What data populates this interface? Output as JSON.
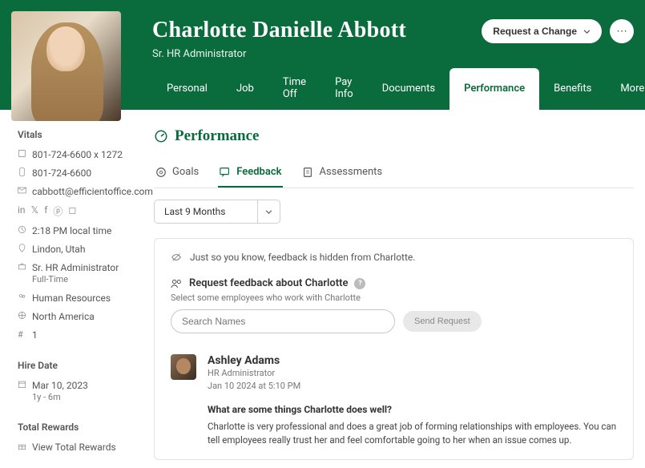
{
  "header": {
    "name": "Charlotte Danielle Abbott",
    "subtitle": "Sr. HR Administrator",
    "request_change_label": "Request a Change",
    "nav": [
      "Personal",
      "Job",
      "Time Off",
      "Pay Info",
      "Documents",
      "Performance",
      "Benefits",
      "More"
    ],
    "active_nav_index": 5
  },
  "sidebar": {
    "vitals_heading": "Vitals",
    "phone_ext": "801-724-6600 x 1272",
    "phone": "801-724-6600",
    "email": "cabbott@efficientoffice.com",
    "local_time": "2:18 PM local time",
    "location": "Lindon, Utah",
    "title": "Sr. HR Administrator",
    "employment_type": "Full-Time",
    "department": "Human Resources",
    "region": "North America",
    "number": "1",
    "hire_heading": "Hire Date",
    "hire_date": "Mar 10, 2023",
    "tenure": "1y - 6m",
    "rewards_heading": "Total Rewards",
    "rewards_link": "View Total Rewards"
  },
  "main": {
    "page_title": "Performance",
    "subtabs": [
      "Goals",
      "Feedback",
      "Assessments"
    ],
    "active_subtab_index": 1,
    "filter_value": "Last 9 Months",
    "hidden_hint": "Just so you know, feedback is hidden from Charlotte.",
    "request_heading": "Request feedback about Charlotte",
    "request_caption": "Select some employees who work with Charlotte",
    "search_placeholder": "Search Names",
    "send_label": "Send Request",
    "feedback": {
      "author": "Ashley Adams",
      "role": "HR Administrator",
      "date": "Jan 10 2024 at 5:10 PM",
      "question": "What are some things Charlotte does well?",
      "answer": "Charlotte is very professional and does a great job of forming relationships with employees. You can tell employees really trust her and feel comfortable going to her when an issue comes up."
    }
  }
}
